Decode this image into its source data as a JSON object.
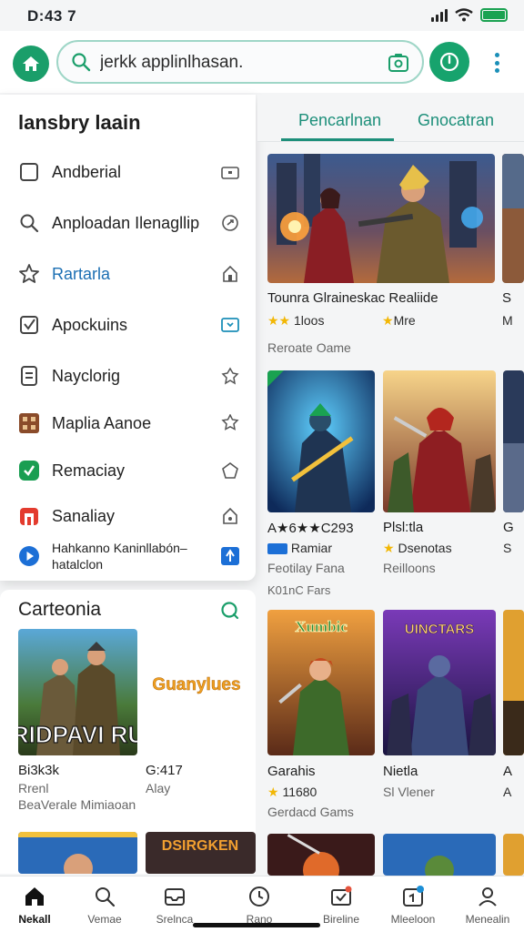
{
  "status_bar": {
    "time": "D:43 7"
  },
  "search": {
    "placeholder": "jerkk applinlhasan."
  },
  "drawer": {
    "title": "lansbry laain",
    "items": [
      {
        "label": "Andberial",
        "icon": "square-icon"
      },
      {
        "label": "Anploadan Ilenagllip",
        "icon": "search-icon"
      },
      {
        "label": "Rartarla",
        "icon": "star-outline-icon"
      },
      {
        "label": "Apockuins",
        "icon": "checkbox-icon"
      },
      {
        "label": "Nayclorig",
        "icon": "document-icon"
      },
      {
        "label": "Maplia Aanoe",
        "icon": "brown-grid-icon"
      },
      {
        "label": "Remaciay",
        "icon": "green-check-icon"
      },
      {
        "label": "Sanaliay",
        "icon": "red-shop-icon"
      },
      {
        "label": "Hahkanno Kaninllabón–hatalclon",
        "icon": "blue-play-icon"
      }
    ]
  },
  "tabs": [
    {
      "label": "Pencarlnan"
    },
    {
      "label": "Gnocatran"
    }
  ],
  "featured": {
    "title": "Tounra Glraineskac Realiide",
    "title_cut": "S",
    "rating": "1loos",
    "rating2": "Mre",
    "rating3": "M",
    "category": "Reroate Oame"
  },
  "grid_row1": [
    {
      "title": "A★6★★C293",
      "sub": "Ramiar",
      "sub2": "Feotilay Fana",
      "sub3": "K01nC Fars"
    },
    {
      "title": "Plsl:tla",
      "sub": "Dsenotas",
      "sub2": "Reilloons"
    },
    {
      "title": "G",
      "sub": "S"
    }
  ],
  "grid_row2": [
    {
      "art_text": "Xumbic",
      "title": "Garahis",
      "rating": "11680",
      "sub": "Gerdacd Gams"
    },
    {
      "art_text": "UINCTARS",
      "title": "Nietla",
      "sub": "Sl Vlener"
    },
    {
      "title": "A",
      "sub": "A"
    }
  ],
  "categories": {
    "title": "Carteonia",
    "cards": [
      {
        "art_text": "RIDPAVI RU",
        "title": "Bi3k3k",
        "sub": "Rrenl",
        "sub2": "BeaVerale Mimiaoan"
      },
      {
        "art_text": "Guanylues",
        "title": "G:417",
        "sub": "Alay"
      }
    ],
    "bottom_art": "DSIRGKEN"
  },
  "bottom_nav": [
    {
      "label": "Nekall",
      "icon": "home-icon",
      "active": true
    },
    {
      "label": "Vemae",
      "icon": "search-icon",
      "active": false
    },
    {
      "label": "Srelnca",
      "icon": "inbox-icon",
      "active": false
    },
    {
      "label": "Rano",
      "icon": "clock-icon",
      "active": false
    },
    {
      "label": "Bireline",
      "icon": "mail-check-icon",
      "active": false
    },
    {
      "label": "Mleeloon",
      "icon": "calendar-icon",
      "active": false
    },
    {
      "label": "Menealin",
      "icon": "person-icon",
      "active": false
    }
  ],
  "colors": {
    "accent": "#1a9e6a",
    "link": "#1c6fb3",
    "tab": "#1d8f7a"
  }
}
